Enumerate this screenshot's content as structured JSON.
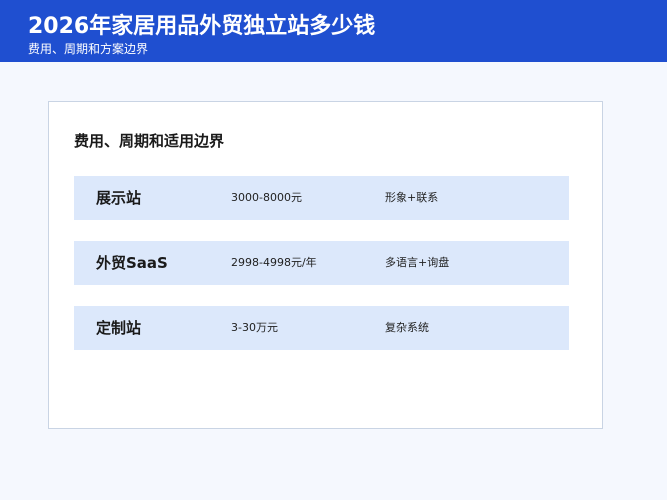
{
  "header": {
    "title": "2026年家居用品外贸独立站多少钱",
    "subtitle": "费用、周期和方案边界"
  },
  "card": {
    "title": "费用、周期和适用边界",
    "rows": [
      {
        "name": "展示站",
        "price": "3000-8000元",
        "desc": "形象+联系"
      },
      {
        "name": "外贸SaaS",
        "price": "2998-4998元/年",
        "desc": "多语言+询盘"
      },
      {
        "name": "定制站",
        "price": "3-30万元",
        "desc": "复杂系统"
      }
    ]
  },
  "colors": {
    "header_bg": "#1f4fd0",
    "row_bg": "#dce8fb",
    "page_bg": "#f5f8fe",
    "card_border": "#c9d4e4"
  }
}
